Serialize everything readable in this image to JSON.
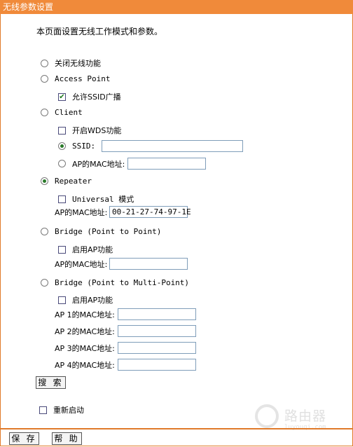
{
  "title": "无线参数设置",
  "description": "本页面设置无线工作模式和参数。",
  "modes": {
    "off": "关闭无线功能",
    "ap": "Access Point",
    "ap_ssid_broadcast": "允许SSID广播",
    "client": "Client",
    "client_wds": "开启WDS功能",
    "client_ssid": "SSID:",
    "client_ap_mac": "AP的MAC地址:",
    "repeater": "Repeater",
    "repeater_universal": "Universal 模式",
    "repeater_mac_label": "AP的MAC地址:",
    "repeater_mac_value": "00-21-27-74-97-1E",
    "bridge_p2p": "Bridge (Point to Point)",
    "bridge_p2p_enable_ap": "启用AP功能",
    "bridge_p2p_mac_label": "AP的MAC地址:",
    "bridge_p2mp": "Bridge (Point to Multi-Point)",
    "bridge_p2mp_enable_ap": "启用AP功能",
    "bridge_p2mp_macs": [
      "AP 1的MAC地址:",
      "AP 2的MAC地址:",
      "AP 3的MAC地址:",
      "AP 4的MAC地址:"
    ]
  },
  "search_button": "搜 索",
  "reboot_label": "重新启动",
  "footer": {
    "save": "保 存",
    "help": "帮 助"
  },
  "watermark": {
    "text": "路由器",
    "sub": "luyouqi.com"
  },
  "selected_mode": "repeater",
  "colors": {
    "accent": "#f08a3a",
    "radio_dot": "#2a7a2a"
  }
}
